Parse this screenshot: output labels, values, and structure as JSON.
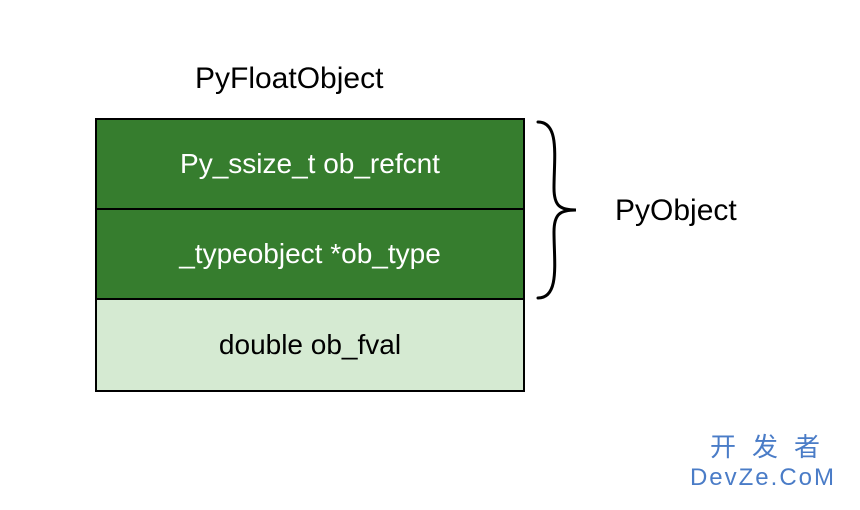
{
  "title": "PyFloatObject",
  "rows": [
    {
      "text": "Py_ssize_t ob_refcnt",
      "variant": "dark"
    },
    {
      "text": "_typeobject *ob_type",
      "variant": "dark"
    },
    {
      "text": "double ob_fval",
      "variant": "light"
    }
  ],
  "brace": {
    "label": "PyObject",
    "spans_rows": 2
  },
  "watermark": {
    "line1": "开发者",
    "line2": "DevZe.CoM"
  },
  "colors": {
    "dark_bg": "#367d2e",
    "light_bg": "#d5ead2",
    "border": "#000000",
    "watermark": "#4a7cc7"
  }
}
